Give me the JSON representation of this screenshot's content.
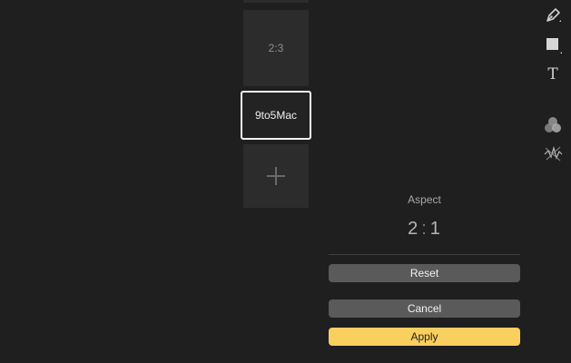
{
  "presets": {
    "items": [
      {
        "label": "2:3"
      },
      {
        "label": "9to5Mac",
        "selected": true
      }
    ],
    "add_icon": "plus-icon"
  },
  "aspect": {
    "label": "Aspect",
    "value_left": "2",
    "value_sep": ":",
    "value_right": "1"
  },
  "buttons": {
    "reset": "Reset",
    "cancel": "Cancel",
    "apply": "Apply"
  },
  "toolbar": {
    "icons": [
      "pen-icon",
      "shape-icon",
      "text-icon",
      "color-adjust-icon",
      "noise-icon"
    ],
    "text_glyph": "T"
  },
  "colors": {
    "background": "#1f1f1f",
    "tile": "#2c2c2c",
    "button": "#5a5a5a",
    "accent": "#f9cf5f"
  }
}
